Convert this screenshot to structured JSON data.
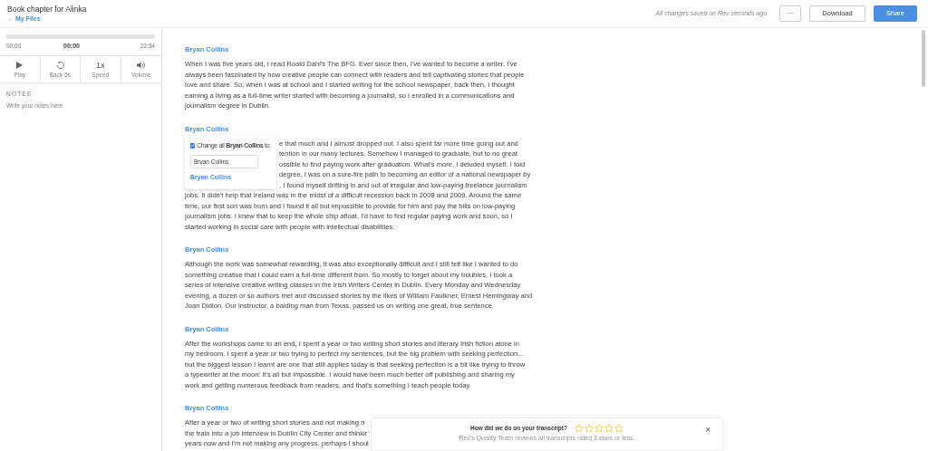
{
  "header": {
    "title": "Book chapter for Alinka",
    "back_link": "← My Files",
    "save_status": "All changes saved on Rev seconds ago.",
    "more_button": "···",
    "download_button": "Download",
    "share_button": "Share"
  },
  "player": {
    "level": 0,
    "start_time": "00:00",
    "current_time": "00:00",
    "end_time": "23:34",
    "controls": [
      {
        "kind": "play",
        "label": "Play"
      },
      {
        "kind": "back",
        "label": "Back 5s"
      },
      {
        "kind": "speed",
        "glyph": "1x",
        "label": "Speed"
      },
      {
        "kind": "volume",
        "label": "Volume"
      }
    ]
  },
  "notes": {
    "heading": "NOTES",
    "placeholder": "Write your notes here"
  },
  "transcript": [
    {
      "speaker": "Bryan Collins",
      "lines": [
        {
          "text": "When I was five years old, I read Roald Dahl's The BFG. Ever since then, I've wanted to become a writer. I've"
        },
        {
          "text": "always been fascinated by how creative people can connect with readers and tell captivating stories that people"
        },
        {
          "text": "love and share. So, when I was at school and I started writing for the school newspaper, back then, I thought"
        },
        {
          "text": "earning a living as a full-time writer started with becoming a journalist, so I enrolled in a communications and"
        },
        {
          "text": "journalism degree in Dublin."
        }
      ]
    },
    {
      "speaker": "Bryan Collins",
      "lines": [
        {
          "text": "e that much and I almost dropped out. I also spent far more time going out and",
          "covered": true
        },
        {
          "text": "tention in our many lectures. Somehow I managed to graduate, but to no great",
          "covered": true
        },
        {
          "text": "ossible to find paying work after graduation. What's more, I deluded myself. I told",
          "covered": true
        },
        {
          "text": "degree, I was on a sure-fire path to becoming an editor of a national newspaper by",
          "covered": true
        },
        {
          "text": ", I found myself drifting in and out of irregular and low-paying freelance journalism",
          "covered": true
        },
        {
          "text": "jobs. It didn't help that Ireland was in the midst of a difficult recession back in 2008 and 2009. Around the same"
        },
        {
          "text": "time, our first son was born and I found it all but impossible to provide for him and pay the bills on low-paying"
        },
        {
          "text": "journalism jobs. I knew that to keep the whole ship afloat, I'd have to find regular paying work and soon, so I"
        },
        {
          "text": "started working in social care with people with intellectual disabilities."
        }
      ],
      "rename_popup": {
        "checked": true,
        "label": "Change all **Bryan Collins** to:",
        "value": "Bryan Collins",
        "suggestion": "Bryan Collins"
      }
    },
    {
      "speaker": "Bryan Collins",
      "lines": [
        {
          "text": "Although the work was somewhat rewarding, it was also exceptionally difficult and I still felt like I wanted to do"
        },
        {
          "text": "something creative that I could earn a full-time different from. So mostly to forget about my troubles, I took a"
        },
        {
          "text": "series of intensive creative writing classes in the Irish Writers Center in Dublin. Every Monday and Wednesday"
        },
        {
          "text": "evening, a dozen or so authors met and discussed stories by the likes of William Faulkner, Ernest Hemingway and"
        },
        {
          "text": "Joan Didion. Our instructor, a balding man from Texas, passed us on writing one great, true sentence."
        }
      ]
    },
    {
      "speaker": "Bryan Collins",
      "lines": [
        {
          "text": "After the workshops came to an end, I spent a year or two writing short stories and literary Irish fiction alone in"
        },
        {
          "text": "my bedroom. I spent a year or two trying to perfect my sentences, but the big problem with seeking perfection..."
        },
        {
          "text": "but the biggest lesson I learnt are one that still applies today is that seeking perfection is a bit like trying to throw"
        },
        {
          "text": "a typewriter at the moon: it's all but impossible. I would have been much better off publishing and sharing my"
        },
        {
          "text": "work and getting numerous feedback from readers, and that's something I teach people today."
        }
      ]
    },
    {
      "speaker": "Bryan Collins",
      "lines": [
        {
          "text": "After a year or two of writing short stories and not making n"
        },
        {
          "text": "the train into a job interview in Dublin City Center and thinkir"
        },
        {
          "text": "years now and I'm not making any progress, perhaps I shoul"
        }
      ]
    }
  ],
  "rating": {
    "question": "How did we do on your transcript?",
    "stars": 0,
    "note": "Rev's Quality Team reviews all transcripts rated 3 stars or less.",
    "close": "×"
  }
}
